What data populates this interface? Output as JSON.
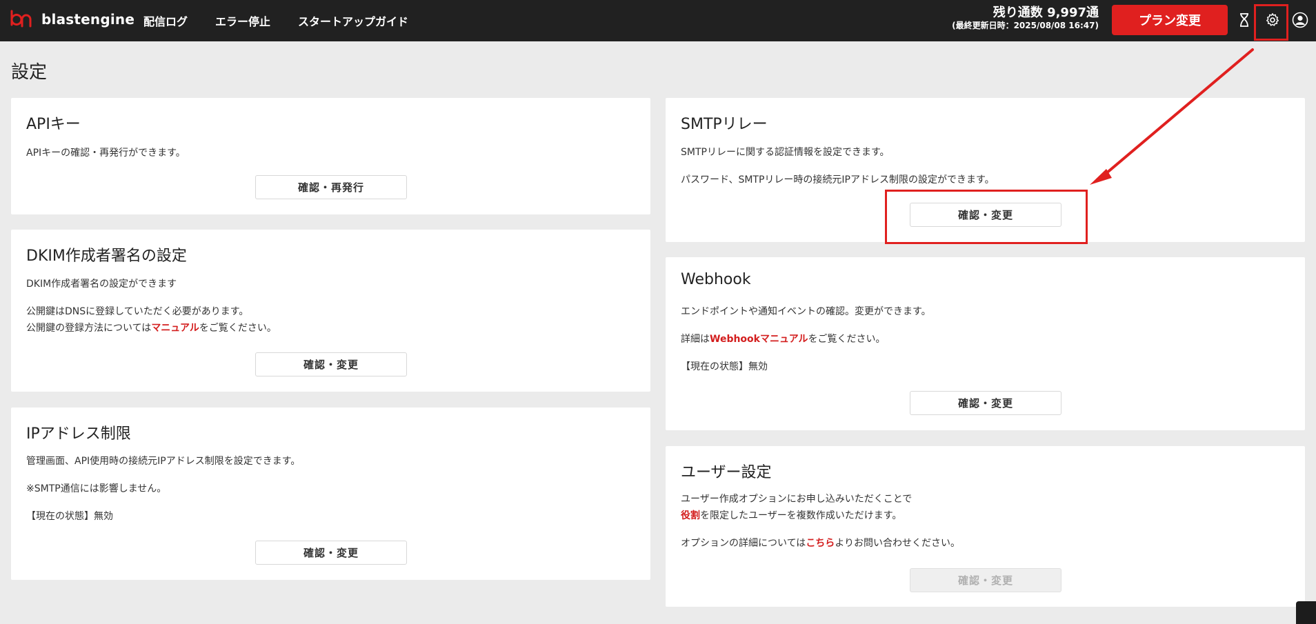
{
  "header": {
    "logo_text": "blastengine",
    "nav": [
      "配信ログ",
      "エラー停止",
      "スタートアップガイド"
    ],
    "remaining": "残り通数 9,997通",
    "last_updated": "(最終更新日時：2025/08/08 16:47)",
    "plan_button": "プラン変更",
    "icons": [
      "hourglass-icon",
      "gear-icon",
      "user-icon"
    ]
  },
  "page": {
    "title": "設定"
  },
  "cards": {
    "api_key": {
      "title": "APIキー",
      "desc": "APIキーの確認・再発行ができます。",
      "button": "確認・再発行"
    },
    "dkim": {
      "title": "DKIM作成者署名の設定",
      "desc1": "DKIM作成者署名の設定ができます",
      "desc2": "公開鍵はDNSに登録していただく必要があります。",
      "desc3_before": "公開鍵の登録方法については",
      "desc3_link": "マニュアル",
      "desc3_after": "をご覧ください。",
      "button": "確認・変更"
    },
    "ip": {
      "title": "IPアドレス制限",
      "desc1": "管理画面、API使用時の接続元IPアドレス制限を設定できます。",
      "desc2": "※SMTP通信には影響しません。",
      "status": "【現在の状態】無効",
      "button": "確認・変更"
    },
    "smtp": {
      "title": "SMTPリレー",
      "desc1": "SMTPリレーに関する認証情報を設定できます。",
      "desc2": "パスワード、SMTPリレー時の接続元IPアドレス制限の設定ができます。",
      "button": "確認・変更"
    },
    "webhook": {
      "title": "Webhook",
      "desc1": "エンドポイントや通知イベントの確認。変更ができます。",
      "desc2_before": "詳細は",
      "desc2_link": "Webhookマニュアル",
      "desc2_after": "をご覧ください。",
      "status": "【現在の状態】無効",
      "button": "確認・変更"
    },
    "user": {
      "title": "ユーザー設定",
      "desc1": "ユーザー作成オプションにお申し込みいただくことで",
      "desc2_link": "役割",
      "desc2_after": "を限定したユーザーを複数作成いただけます。",
      "desc3_before": "オプションの詳細については",
      "desc3_link": "こちら",
      "desc3_after": "よりお問い合わせください。",
      "button": "確認・変更"
    }
  },
  "colors": {
    "accent": "#e0201f",
    "header_bg": "#212121",
    "page_bg": "#ebebeb"
  }
}
